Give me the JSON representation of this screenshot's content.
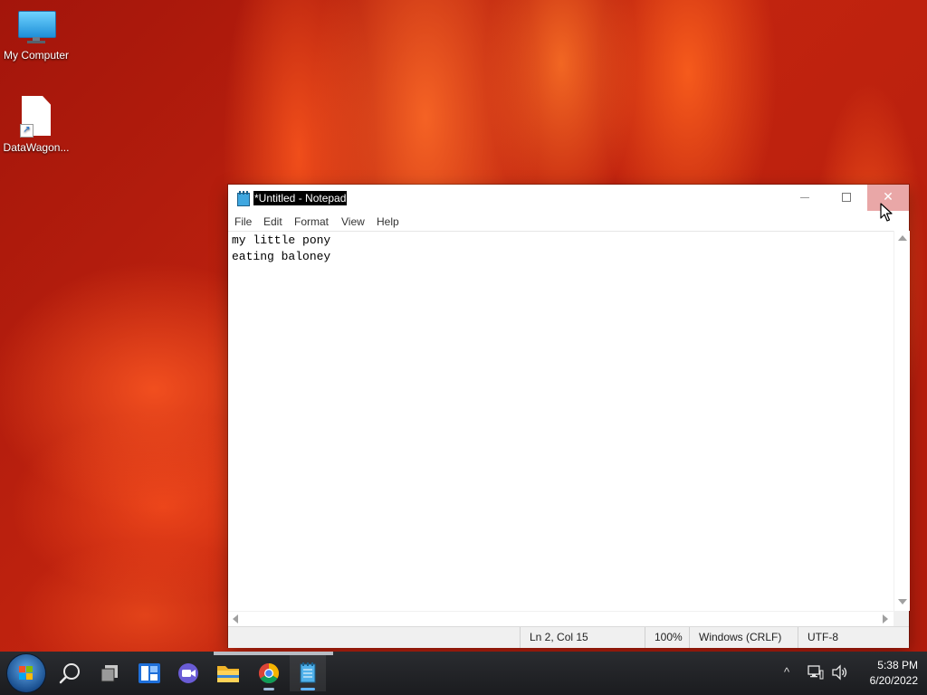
{
  "desktop": {
    "icons": [
      {
        "label": "My Computer",
        "icon": "computer-icon"
      },
      {
        "label": "DataWagon...",
        "icon": "file-shortcut-icon"
      }
    ]
  },
  "notepad": {
    "title": "*Untitled - Notepad",
    "menu": [
      "File",
      "Edit",
      "Format",
      "View",
      "Help"
    ],
    "content_lines": [
      "my little pony",
      "eating baloney"
    ],
    "status": {
      "position": "Ln 2, Col 15",
      "zoom": "100%",
      "line_ending": "Windows (CRLF)",
      "encoding": "UTF-8"
    },
    "caption_buttons": [
      "minimize-icon",
      "maximize-icon",
      "close-icon"
    ],
    "close_hover_color": "#e9a7a7"
  },
  "taskbar": {
    "items": [
      "start-button",
      "search-icon",
      "task-view-icon",
      "widgets-icon",
      "meet-icon",
      "file-explorer-icon",
      "chrome-icon",
      "notepad-icon"
    ],
    "active_item": "notepad-icon",
    "tray": {
      "chevron": "^",
      "time": "5:38 PM",
      "date": "6/20/2022"
    }
  },
  "colors": {
    "wallpaper": "#b81d0e",
    "taskbar": "#1f2023",
    "title_highlight": "#000000",
    "accent": "#5fb3ff"
  }
}
